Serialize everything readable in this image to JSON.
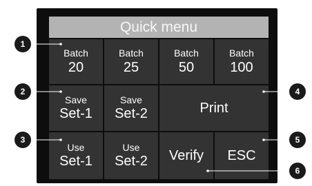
{
  "quick_menu": {
    "title": "Quick menu",
    "buttons": {
      "batch_20": {
        "line1": "Batch",
        "line2": "20"
      },
      "batch_25": {
        "line1": "Batch",
        "line2": "25"
      },
      "batch_50": {
        "line1": "Batch",
        "line2": "50"
      },
      "batch_100": {
        "line1": "Batch",
        "line2": "100"
      },
      "save_set1": {
        "line1": "Save",
        "line2": "Set-1"
      },
      "save_set2": {
        "line1": "Save",
        "line2": "Set-2"
      },
      "print": {
        "label": "Print"
      },
      "use_set1": {
        "line1": "Use",
        "line2": "Set-1"
      },
      "use_set2": {
        "line1": "Use",
        "line2": "Set-2"
      },
      "verify": {
        "label": "Verify"
      },
      "esc": {
        "label": "ESC"
      }
    }
  },
  "callouts": [
    "1",
    "2",
    "3",
    "4",
    "5",
    "6"
  ]
}
